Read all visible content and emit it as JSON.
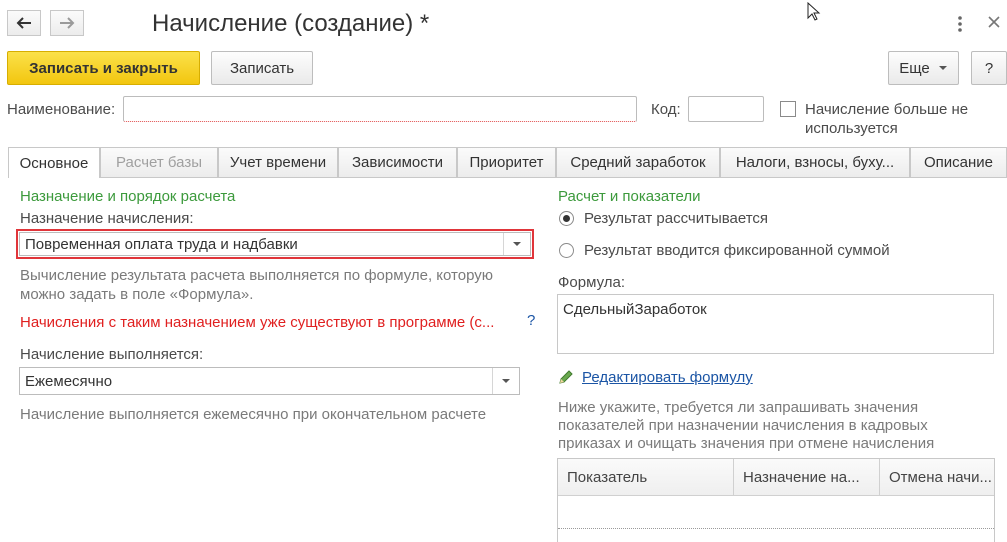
{
  "window": {
    "title": "Начисление (создание) *",
    "more_icon": "vertical-dots",
    "close_icon": "close"
  },
  "toolbar": {
    "save_close_label": "Записать и закрыть",
    "save_label": "Записать",
    "more_label": "Еще",
    "help_label": "?"
  },
  "header": {
    "name_label": "Наименование:",
    "name_value": "",
    "code_label": "Код:",
    "code_value": "",
    "not_used_label_line1": "Начисление больше не",
    "not_used_label_line2": "используется",
    "not_used_checked": false
  },
  "tabs": [
    {
      "label": "Основное",
      "active": true,
      "disabled": false
    },
    {
      "label": "Расчет базы",
      "active": false,
      "disabled": true
    },
    {
      "label": "Учет времени",
      "active": false,
      "disabled": false
    },
    {
      "label": "Зависимости",
      "active": false,
      "disabled": false
    },
    {
      "label": "Приоритет",
      "active": false,
      "disabled": false
    },
    {
      "label": "Средний заработок",
      "active": false,
      "disabled": false
    },
    {
      "label": "Налоги, взносы, буху...",
      "active": false,
      "disabled": false
    },
    {
      "label": "Описание",
      "active": false,
      "disabled": false
    }
  ],
  "left": {
    "section_title": "Назначение и порядок расчета",
    "purpose_label": "Назначение начисления:",
    "purpose_value": "Повременная оплата труда и надбавки",
    "hint_line1": "Вычисление результата расчета выполняется по формуле, которую",
    "hint_line2": "можно задать в поле «Формула».",
    "warning": "Начисления с таким назначением уже существуют в программе (с...",
    "help_mark": "?",
    "performed_label": "Начисление выполняется:",
    "performed_value": "Ежемесячно",
    "performed_hint": "Начисление выполняется ежемесячно при окончательном расчете"
  },
  "right": {
    "section_title": "Расчет и показатели",
    "radio_calculated": "Результат рассчитывается",
    "radio_fixed": "Результат вводится фиксированной суммой",
    "selected": "calculated",
    "formula_label": "Формула:",
    "formula_value": "СдельныйЗаработок",
    "edit_formula_link": "Редактировать формулу",
    "note_line1": "Ниже укажите, требуется ли запрашивать значения",
    "note_line2": "показателей при назначении начисления в кадровых",
    "note_line3": "приказах и очищать значения при отмене начисления",
    "table_headers": [
      "Показатель",
      "Назначение на...",
      "Отмена начи..."
    ]
  },
  "colors": {
    "accent_yellow": "#f5cc1c",
    "section_green": "#3c9a3c",
    "warning_red": "#e02020",
    "highlight_border": "#e0353a",
    "link_blue": "#1b55a5"
  }
}
